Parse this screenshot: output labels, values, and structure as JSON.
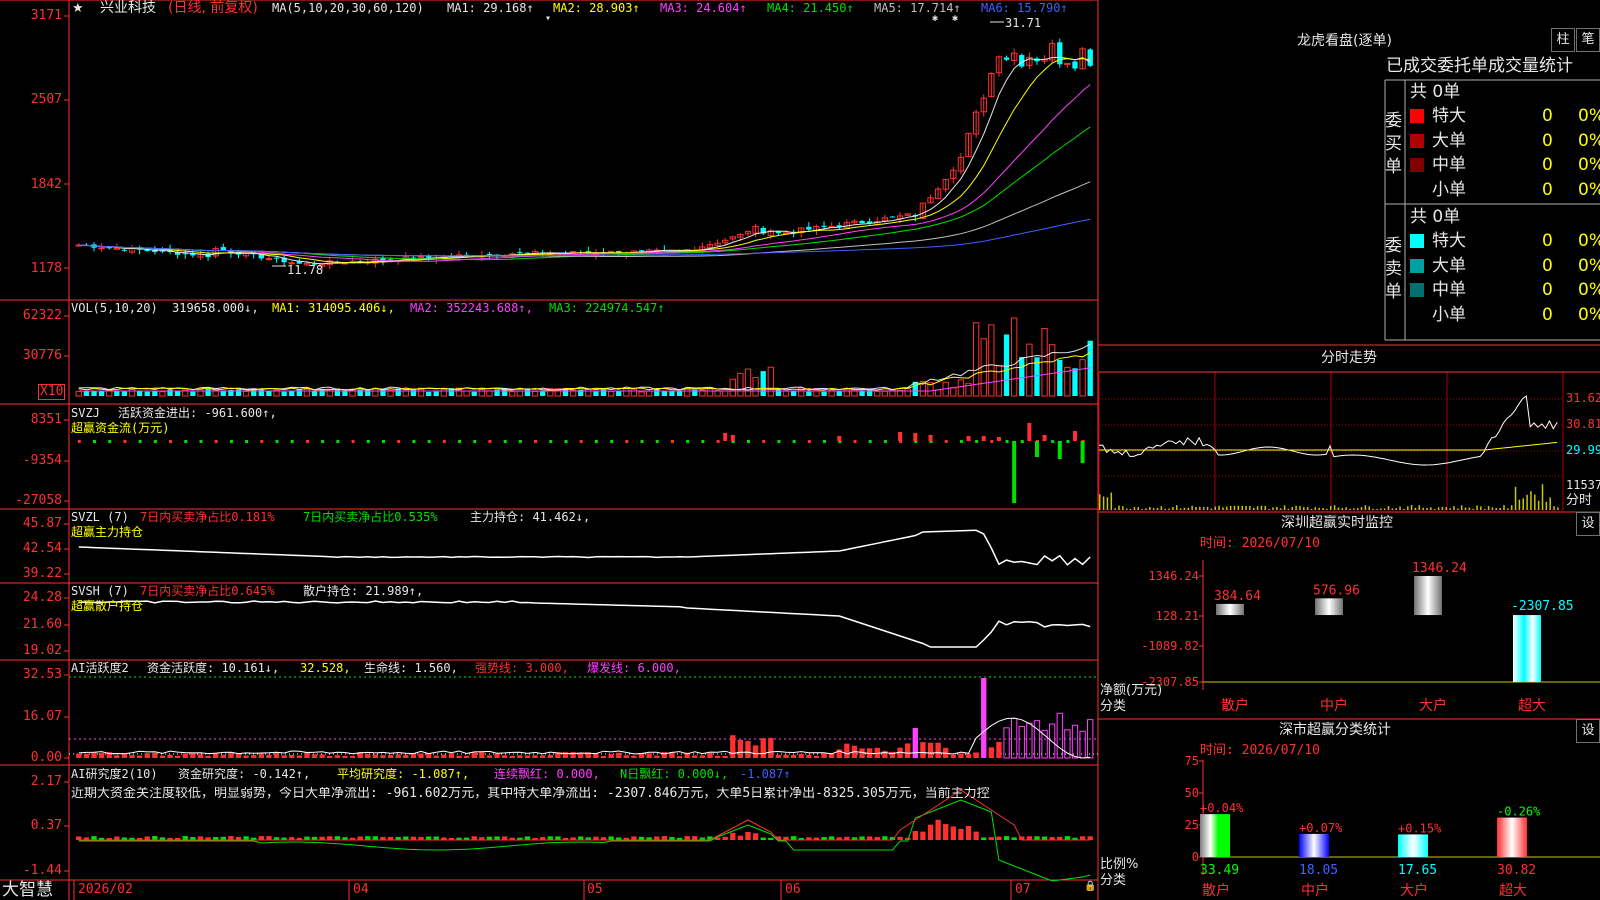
{
  "stock": {
    "star": "★",
    "name": "兴业科技",
    "period": "(日线, 前复权)",
    "ma_title": "MA(5,10,20,30,60,120)",
    "ma1": "MA1: 29.168↑",
    "ma2": "MA2: 28.903↑",
    "ma3": "MA3: 24.604↑",
    "ma4": "MA4: 21.450↑",
    "ma5": "MA5: 17.714↑",
    "ma6": "MA6: 15.790↑",
    "high_label": "31.71",
    "low_label": "11.78"
  },
  "colors": {
    "bg": "#000000",
    "up": "#ff3030",
    "down": "#00ffff",
    "ma1": "#e6e6e6",
    "ma2": "#ffff00",
    "ma3": "#ff40ff",
    "ma4": "#00e000",
    "ma5": "#c0c0c0",
    "ma6": "#4060ff",
    "grid": "#b00000"
  },
  "price_axis": [
    "3171",
    "2507",
    "1842",
    "1178"
  ],
  "vol": {
    "title": "VOL(5,10,20)",
    "value": "319658.000↓,",
    "ma1": "MA1: 314095.406↓,",
    "ma2": "MA2: 352243.688↑,",
    "ma3": "MA3: 224974.547↑",
    "axis": [
      "62322",
      "30776"
    ],
    "x10": "X10"
  },
  "svzj": {
    "title": "SVZJ",
    "label": "活跃资金进出: -961.600↑,",
    "sub": "超赢资金流(万元)",
    "axis": [
      "8351",
      "-9354",
      "-27058"
    ]
  },
  "svzl": {
    "title": "SVZL (7)",
    "t1": "7日内买卖净占比0.181%",
    "t2": "7日内买卖净占比0.535%",
    "t3": "主力持仓: 41.462↓,",
    "sub": "超赢主力持仓",
    "axis": [
      "45.87",
      "42.54",
      "39.22"
    ]
  },
  "svsh": {
    "title": "SVSH (7)",
    "t1": "7日内买卖净占比0.645%",
    "t3": "散户持仓: 21.989↑,",
    "sub": "超赢散户持仓",
    "axis": [
      "24.28",
      "21.60",
      "19.02"
    ]
  },
  "ai1": {
    "title": "AI活跃度2",
    "t1": "资金活跃度: 10.161↓,",
    "t2": "32.528,",
    "t3": "生命线: 1.560,",
    "t4": "强势线: 3.000,",
    "t5": "爆发线: 6.000,",
    "axis": [
      "32.53",
      "16.07",
      "0.00"
    ]
  },
  "ai2": {
    "title": "AI研究度2(10)",
    "t1": "资金研究度: -0.142↑,",
    "t2": "平均研究度: -1.087↑,",
    "t3": "连续飘红: 0.000,",
    "t4": "N日飘红: 0.000↓,",
    "t5": "-1.087↑",
    "note": "近期大资金关注度较低，明显弱势，今日大单净流出: -961.602万元，其中特大单净流出: -2307.846万元，大单5日累计净出-8325.305万元，当前主力控",
    "axis": [
      "2.17",
      "0.37",
      "-1.44"
    ]
  },
  "xaxis": {
    "brand": "大智慧",
    "labels": [
      "2026/02",
      "04",
      "05",
      "06",
      "07"
    ]
  },
  "dragon": {
    "title": "龙虎看盘(逐单)",
    "btn1": "柱",
    "btn2": "笔",
    "header": "已成交委托单成交量统计",
    "buy_side": "委买单",
    "sell_side": "委卖单",
    "buy_total": "共 0单",
    "sell_total": "共 0单",
    "buy_rows": [
      {
        "label": "特大",
        "n": "0",
        "p": "0%",
        "color": "#ff0000"
      },
      {
        "label": "大单",
        "n": "0",
        "p": "0%",
        "color": "#b00000"
      },
      {
        "label": "中单",
        "n": "0",
        "p": "0%",
        "color": "#800000"
      },
      {
        "label": "小单",
        "n": "0",
        "p": "0%",
        "color": "#000000"
      }
    ],
    "sell_rows": [
      {
        "label": "特大",
        "n": "0",
        "p": "0%",
        "color": "#00ffff"
      },
      {
        "label": "大单",
        "n": "0",
        "p": "0%",
        "color": "#00a0a0"
      },
      {
        "label": "中单",
        "n": "0",
        "p": "0%",
        "color": "#007070"
      },
      {
        "label": "小单",
        "n": "0",
        "p": "0%",
        "color": "#000000"
      }
    ]
  },
  "intraday": {
    "title": "分时走势",
    "axis": [
      "31.62",
      "30.81",
      "29.99"
    ],
    "vol_label": "11537",
    "time_label": "分时"
  },
  "monitor": {
    "title": "深圳超赢实时监控",
    "btn": "设",
    "time": "时间: 2026/07/10",
    "ylabel": "净额(万元)",
    "xlabel": "分类",
    "axis": [
      "1346.24",
      "128.21",
      "-1089.82",
      "-2307.85"
    ],
    "chart_data": {
      "type": "bar",
      "categories": [
        "散户",
        "中户",
        "大户",
        "超大"
      ],
      "values": [
        384.64,
        576.96,
        1346.24,
        -2307.85
      ],
      "labels": [
        "384.64",
        "576.96",
        "1346.24",
        "-2307.85"
      ],
      "ylim": [
        -2307.85,
        1346.24
      ]
    }
  },
  "classify": {
    "title": "深市超赢分类统计",
    "btn": "设",
    "time": "时间: 2026/07/10",
    "ylabel": "比例%",
    "xlabel": "分类",
    "axis": [
      "75",
      "50",
      "25",
      "0"
    ],
    "chart_data": {
      "type": "bar",
      "categories": [
        "散户",
        "中户",
        "大户",
        "超大"
      ],
      "values": [
        33.49,
        18.05,
        17.65,
        30.82
      ],
      "changes": [
        "+0.04%",
        "+0.07%",
        "+0.15%",
        "-0.26%"
      ],
      "ylim": [
        0,
        75
      ]
    }
  }
}
